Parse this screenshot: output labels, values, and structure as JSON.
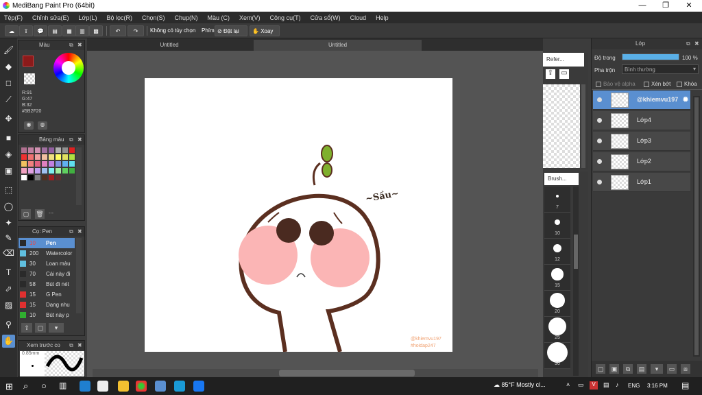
{
  "window": {
    "title": "MediBang Paint Pro (64bit)",
    "min": "—",
    "max": "❐",
    "close": "✕"
  },
  "menu": [
    "Tệp(F)",
    "Chỉnh sửa(E)",
    "Lớp(L)",
    "Bộ lọc(R)",
    "Chọn(S)",
    "Chụp(N)",
    "Màu (C)",
    "Xem(V)",
    "Công cụ(T)",
    "Cửa sổ(W)",
    "Cloud",
    "Help"
  ],
  "toolbar": {
    "no_options": "Không có tùy chọn",
    "key": "Phím",
    "reset": "Đặt lại",
    "rotate": "Xoay"
  },
  "tabs": [
    "Untitled",
    "Untitled"
  ],
  "color_panel": {
    "title": "Màu",
    "r": "R:91",
    "g": "G:47",
    "b": "B:32",
    "hex": "#5B2F20",
    "fg_color": "#5B2F20"
  },
  "palette_panel": {
    "title": "Bảng màu",
    "footer": "---",
    "colors": [
      "#b07090",
      "#c080a0",
      "#d090b0",
      "#a070a0",
      "#9060a0",
      "#b0b0b0",
      "#909090",
      "#e02020",
      "#f03030",
      "#f07070",
      "#f0a0a0",
      "#f0c0a0",
      "#f0e080",
      "#ffff60",
      "#e0e060",
      "#b0e040",
      "#f0c060",
      "#f08080",
      "#e06080",
      "#e080c0",
      "#c080e0",
      "#8090e0",
      "#60b0f0",
      "#60e0f0",
      "#f0a0c0",
      "#e0a0e0",
      "#c0a0f0",
      "#a0c0f0",
      "#80f0f0",
      "#a0f0a0",
      "#60d060",
      "#40b040",
      "#ffffff",
      "#000000",
      "#808080",
      "#503020",
      "#a02020",
      "#603030"
    ]
  },
  "brush_panel": {
    "title": "Cọ: Pen",
    "brushes": [
      {
        "size": "10",
        "name": "Pen",
        "color": "#2a2a2a"
      },
      {
        "size": "200",
        "name": "Watercolor",
        "color": "#60c0e0"
      },
      {
        "size": "30",
        "name": "Loan màu",
        "color": "#60c0e0"
      },
      {
        "size": "70",
        "name": "Cái này đi",
        "color": "#2a2a2a"
      },
      {
        "size": "58",
        "name": "Bút đi nét",
        "color": "#2a2a2a"
      },
      {
        "size": "15",
        "name": "G Pen",
        "color": "#e03030"
      },
      {
        "size": "15",
        "name": "Dạng nhu",
        "color": "#e03030"
      },
      {
        "size": "10",
        "name": "Bút này p",
        "color": "#30b030"
      }
    ]
  },
  "preview_panel": {
    "title": "Xem trước co",
    "size": "0.85mm"
  },
  "reference_panel": {
    "title": "Refer..."
  },
  "brushsize_panel": {
    "title": "Brush...",
    "sizes": [
      "7",
      "10",
      "12",
      "15",
      "20",
      "25",
      "30"
    ]
  },
  "layer_panel": {
    "title": "Lớp",
    "opacity_label": "Độ trong",
    "opacity_value": "100 %",
    "opacity": 1.0,
    "blend_label": "Pha trộn",
    "blend_value": "Bình thường",
    "alpha_protect": "Bảo vệ alpha",
    "clip": "Xén bớt",
    "lock": "Khóa",
    "layers": [
      {
        "name": "@khiemvu197",
        "selected": true
      },
      {
        "name": "Lớp4",
        "selected": false
      },
      {
        "name": "Lớp3",
        "selected": false
      },
      {
        "name": "Lớp2",
        "selected": false
      },
      {
        "name": "Lớp1",
        "selected": false
      }
    ]
  },
  "canvas": {
    "signature": "~Sầu~",
    "watermark1": "@khiemvu197",
    "watermark2": "#hoidap247"
  },
  "taskbar": {
    "weather": "85°F Mostly cl...",
    "lang": "ENG",
    "time": "3:16 PM"
  }
}
